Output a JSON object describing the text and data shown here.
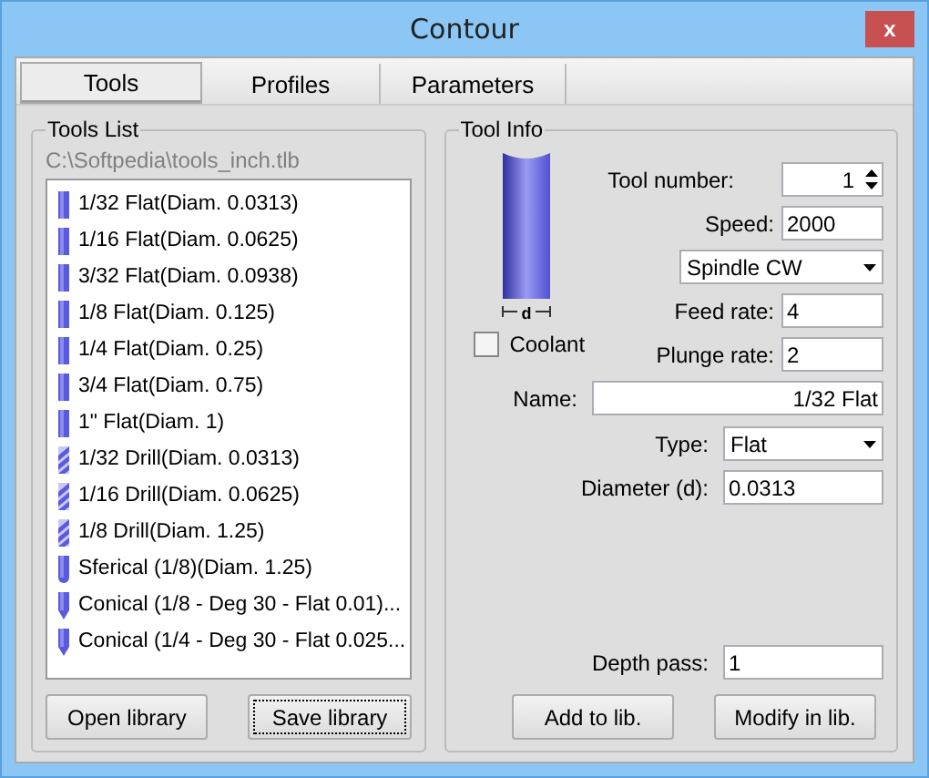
{
  "window": {
    "title": "Contour",
    "close": "x"
  },
  "tabs": [
    {
      "label": "Tools",
      "selected": true
    },
    {
      "label": "Profiles",
      "selected": false
    },
    {
      "label": "Parameters",
      "selected": false
    }
  ],
  "tools_list": {
    "title": "Tools List",
    "path": "C:\\Softpedia\\tools_inch.tlb",
    "items": [
      {
        "label": "1/32 Flat(Diam. 0.0313)",
        "kind": "flat"
      },
      {
        "label": "1/16 Flat(Diam. 0.0625)",
        "kind": "flat"
      },
      {
        "label": "3/32 Flat(Diam. 0.0938)",
        "kind": "flat"
      },
      {
        "label": "1/8 Flat(Diam. 0.125)",
        "kind": "flat"
      },
      {
        "label": "1/4 Flat(Diam. 0.25)",
        "kind": "flat"
      },
      {
        "label": "3/4 Flat(Diam. 0.75)",
        "kind": "flat"
      },
      {
        "label": "1\" Flat(Diam. 1)",
        "kind": "flat"
      },
      {
        "label": "1/32 Drill(Diam. 0.0313)",
        "kind": "drill"
      },
      {
        "label": "1/16 Drill(Diam. 0.0625)",
        "kind": "drill"
      },
      {
        "label": "1/8 Drill(Diam. 1.25)",
        "kind": "drill"
      },
      {
        "label": "Sferical (1/8)(Diam. 1.25)",
        "kind": "ball"
      },
      {
        "label": "Conical (1/8 - Deg 30 - Flat 0.01)...",
        "kind": "conical"
      },
      {
        "label": "Conical (1/4 - Deg 30 - Flat 0.025...",
        "kind": "conical"
      }
    ],
    "buttons": [
      {
        "label": "Open library",
        "focused": false
      },
      {
        "label": "Save library",
        "focused": true
      }
    ]
  },
  "tool_info": {
    "title": "Tool Info",
    "dimension_label": "d",
    "coolant": {
      "label": "Coolant",
      "checked": false
    },
    "fields": [
      {
        "label": "Tool number:",
        "value": "1",
        "kind": "spin"
      },
      {
        "label": "Speed:",
        "value": "2000",
        "kind": "text"
      },
      {
        "value": "Spindle CW",
        "kind": "select"
      },
      {
        "label": "Feed rate:",
        "value": "4",
        "kind": "text"
      },
      {
        "label": "Plunge rate:",
        "value": "2",
        "kind": "text"
      }
    ],
    "name": {
      "label": "Name:",
      "value": "1/32 Flat"
    },
    "type": {
      "label": "Type:",
      "value": "Flat"
    },
    "diameter": {
      "label": "Diameter (d):",
      "value": "0.0313"
    },
    "depth_pass": {
      "label": "Depth pass:",
      "value": "1"
    },
    "buttons": [
      {
        "label": "Add to lib.",
        "focused": false
      },
      {
        "label": "Modify in lib.",
        "focused": false
      }
    ]
  }
}
